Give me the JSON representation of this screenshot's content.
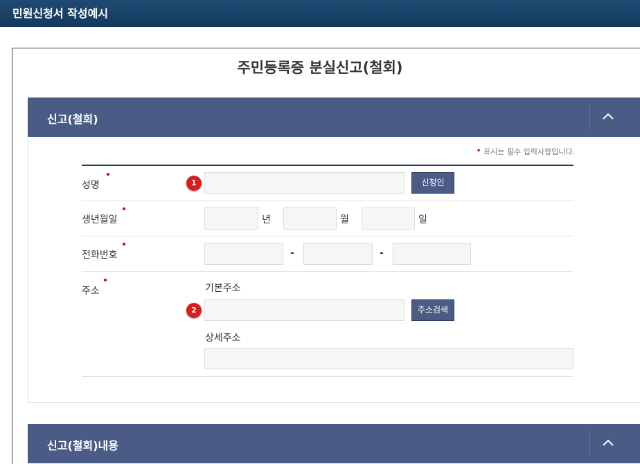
{
  "header": {
    "title": "민원신청서 작성예시"
  },
  "page": {
    "title": "주민등록증 분실신고(철회)"
  },
  "section1": {
    "title": "신고(철회)",
    "required_note": "표시는 필수 입력사항입니다.",
    "fields": {
      "name": {
        "label": "성명",
        "value": "",
        "badge": "1",
        "button": "신청인"
      },
      "birth": {
        "label": "생년월일",
        "year_unit": "년",
        "month_unit": "월",
        "day_unit": "일"
      },
      "phone": {
        "label": "전화번호",
        "sep1": "-",
        "sep2": "-"
      },
      "address": {
        "label": "주소",
        "basic_label": "기본주소",
        "badge": "2",
        "button": "주소검색",
        "detail_label": "상세주소"
      }
    }
  },
  "section2": {
    "title": "신고(철회)내용"
  },
  "colors": {
    "header_bar": "#14395c",
    "panel_header": "#4a5c85",
    "badge": "#d81e1e",
    "required": "#d0021b"
  }
}
